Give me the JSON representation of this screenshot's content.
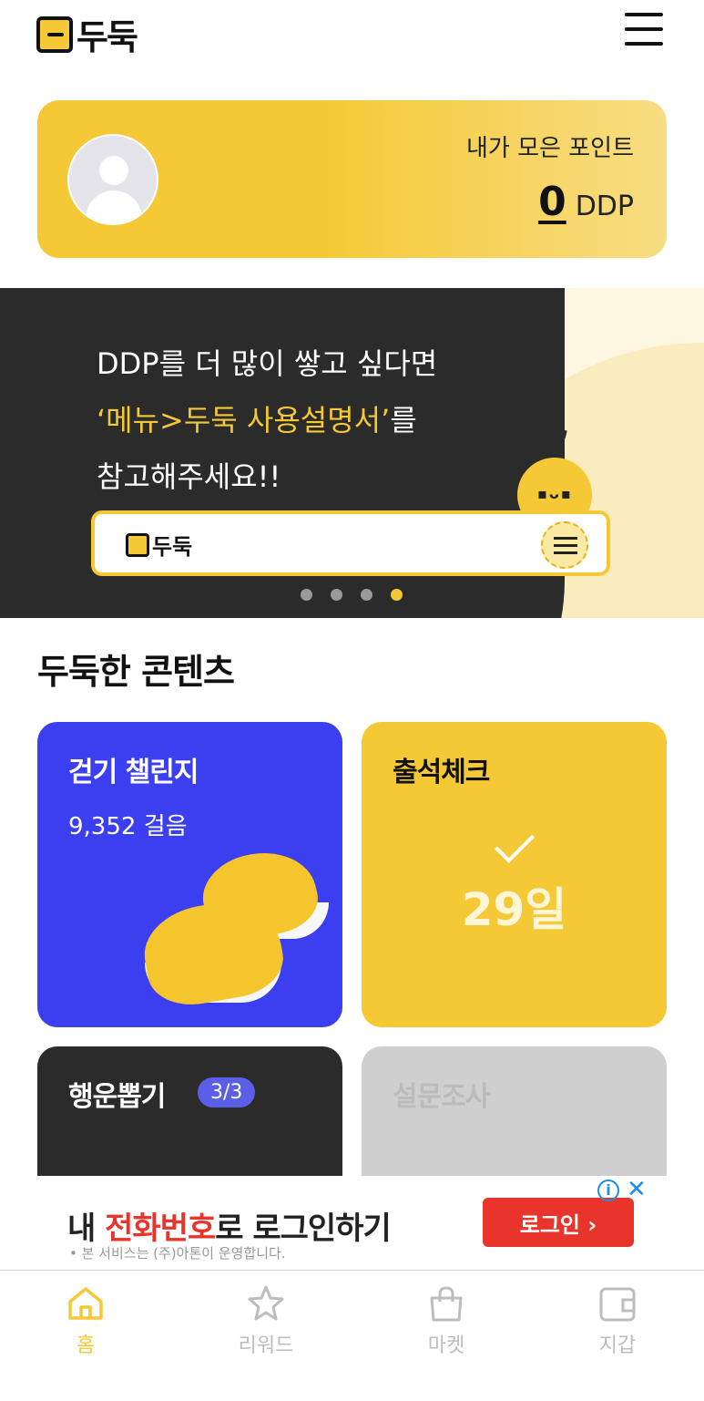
{
  "header": {
    "logo_text": "두둑"
  },
  "points": {
    "label": "내가 모은 포인트",
    "value": "0",
    "unit": "DDP"
  },
  "banner": {
    "line1": "DDP를 더 많이 쌓고 싶다면",
    "line2_highlight": "‘메뉴>두둑 사용설명서’",
    "line2_rest": "를",
    "line3": "참고해주세요!!",
    "mini_logo_text": "두둑",
    "page_count": 4,
    "active_page": 4
  },
  "section": {
    "title": "두둑한 콘텐츠"
  },
  "cards": {
    "walk": {
      "title": "걷기 챌린지",
      "steps": "9,352 걸음"
    },
    "attend": {
      "title": "출석체크",
      "days": "29일"
    },
    "luck": {
      "title": "행운뽑기",
      "badge": "3/3"
    },
    "survey": {
      "title": "설문조사"
    }
  },
  "ad": {
    "title_prefix": "내 ",
    "title_highlight": "전화번호",
    "title_suffix": "로 로그인하기",
    "sub": "• 본 서비스는 (주)아톤이 운영합니다.",
    "button": "로그인 ›",
    "info_icon": "info-icon",
    "close_icon": "close-icon"
  },
  "nav": {
    "items": [
      {
        "label": "홈",
        "icon": "home-icon",
        "active": true
      },
      {
        "label": "리워드",
        "icon": "star-icon",
        "active": false
      },
      {
        "label": "마켓",
        "icon": "shopping-bag-icon",
        "active": false
      },
      {
        "label": "지갑",
        "icon": "wallet-icon",
        "active": false
      }
    ]
  },
  "colors": {
    "accent": "#f5c935",
    "walk_card": "#3b3ff0",
    "dark": "#2b2b2b",
    "ad_red": "#e8342a"
  }
}
